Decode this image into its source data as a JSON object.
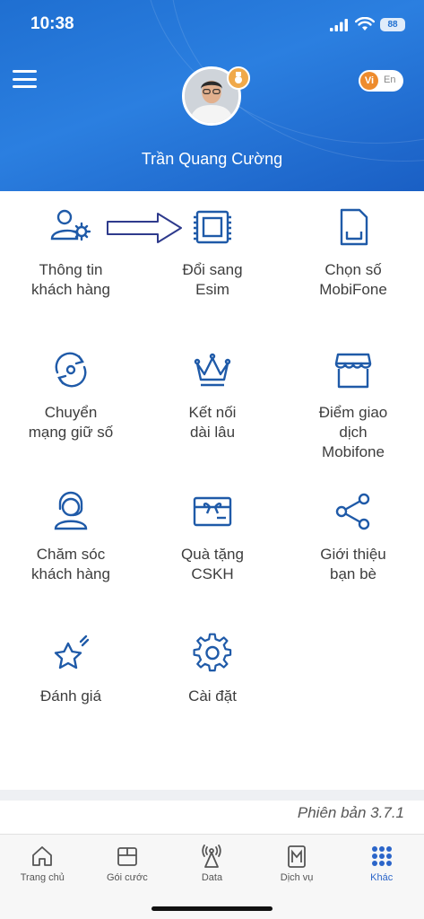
{
  "status": {
    "time": "10:38",
    "battery": "88"
  },
  "header": {
    "user_name": "Trần Quang Cường",
    "lang": {
      "active": "Vi",
      "other": "En"
    }
  },
  "grid": [
    {
      "label": "Thông tin\nkhách hàng",
      "icon": "user-settings-icon"
    },
    {
      "label": "Đổi sang\nEsim",
      "icon": "esim-chip-icon"
    },
    {
      "label": "Chọn số\nMobiFone",
      "icon": "sim-card-icon"
    },
    {
      "label": "Chuyển\nmạng giữ số",
      "icon": "port-number-icon"
    },
    {
      "label": "Kết nối\ndài lâu",
      "icon": "crown-icon"
    },
    {
      "label": "Điểm giao\ndịch\nMobifone",
      "icon": "store-icon"
    },
    {
      "label": "Chăm sóc\nkhách hàng",
      "icon": "customer-support-icon"
    },
    {
      "label": "Quà tặng\nCSKH",
      "icon": "gift-card-icon"
    },
    {
      "label": "Giới thiệu\nbạn bè",
      "icon": "share-icon"
    },
    {
      "label": "Đánh giá",
      "icon": "star-rating-icon"
    },
    {
      "label": "Cài đặt",
      "icon": "gear-icon"
    }
  ],
  "version": "Phiên bản 3.7.1",
  "tabbar": [
    {
      "label": "Trang chủ",
      "icon": "home-icon"
    },
    {
      "label": "Gói cước",
      "icon": "package-icon"
    },
    {
      "label": "Data",
      "icon": "data-antenna-icon"
    },
    {
      "label": "Dịch vụ",
      "icon": "services-icon"
    },
    {
      "label": "Khác",
      "icon": "more-grid-icon",
      "active": true
    }
  ],
  "colors": {
    "brand_blue": "#1f6fd1",
    "icon_blue": "#1f5aa8",
    "active_tab": "#2b65c9",
    "lang_orange": "#ee8b2c"
  }
}
